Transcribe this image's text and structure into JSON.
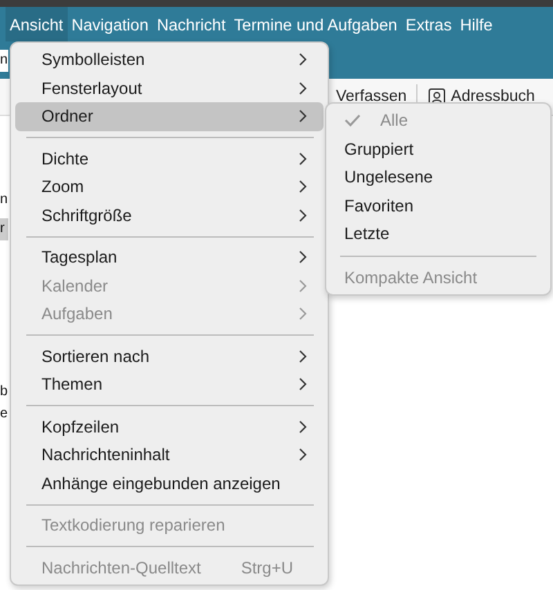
{
  "menubar": [
    {
      "label": "Ansicht",
      "selected": true
    },
    {
      "label": "Navigation",
      "selected": false
    },
    {
      "label": "Nachricht",
      "selected": false
    },
    {
      "label": "Termine und Aufgaben",
      "selected": false
    },
    {
      "label": "Extras",
      "selected": false
    },
    {
      "label": "Hilfe",
      "selected": false
    }
  ],
  "toolbar": [
    {
      "label": "Verfassen"
    },
    {
      "label": "Adressbuch"
    }
  ],
  "left_pane": [
    {
      "text": "n",
      "selected": false
    },
    {
      "text": "n",
      "selected": false
    },
    {
      "text": "r",
      "selected": true
    },
    {
      "text": "b",
      "selected": false
    },
    {
      "text": "e",
      "selected": false
    }
  ],
  "menu": {
    "groups": [
      [
        {
          "kind": "submenu",
          "label": "Symbolleisten",
          "disabled": false,
          "selected": false
        },
        {
          "kind": "submenu",
          "label": "Fensterlayout",
          "disabled": false,
          "selected": false
        },
        {
          "kind": "submenu",
          "label": "Ordner",
          "disabled": false,
          "selected": true
        }
      ],
      [
        {
          "kind": "submenu",
          "label": "Dichte",
          "disabled": false,
          "selected": false
        },
        {
          "kind": "submenu",
          "label": "Zoom",
          "disabled": false,
          "selected": false
        },
        {
          "kind": "submenu",
          "label": "Schriftgröße",
          "disabled": false,
          "selected": false
        }
      ],
      [
        {
          "kind": "submenu",
          "label": "Tagesplan",
          "disabled": false,
          "selected": false
        },
        {
          "kind": "submenu",
          "label": "Kalender",
          "disabled": true,
          "selected": false
        },
        {
          "kind": "submenu",
          "label": "Aufgaben",
          "disabled": true,
          "selected": false
        }
      ],
      [
        {
          "kind": "submenu",
          "label": "Sortieren nach",
          "disabled": false,
          "selected": false
        },
        {
          "kind": "submenu",
          "label": "Themen",
          "disabled": false,
          "selected": false
        }
      ],
      [
        {
          "kind": "submenu",
          "label": "Kopfzeilen",
          "disabled": false,
          "selected": false
        },
        {
          "kind": "submenu",
          "label": "Nachrichteninhalt",
          "disabled": false,
          "selected": false
        },
        {
          "kind": "command",
          "label": "Anhänge eingebunden anzeigen",
          "disabled": false,
          "selected": false
        }
      ],
      [
        {
          "kind": "command",
          "label": "Textkodierung reparieren",
          "disabled": true,
          "selected": false
        }
      ],
      [
        {
          "kind": "command",
          "label": "Nachrichten-Quelltext",
          "disabled": true,
          "selected": false,
          "shortcut": "Strg+U"
        }
      ]
    ]
  },
  "submenu": {
    "groups": [
      [
        {
          "label": "Alle",
          "checked": true,
          "disabled": true
        },
        {
          "label": "Gruppiert",
          "checked": false,
          "disabled": false
        },
        {
          "label": "Ungelesene",
          "checked": false,
          "disabled": false
        },
        {
          "label": "Favoriten",
          "checked": false,
          "disabled": false
        },
        {
          "label": "Letzte",
          "checked": false,
          "disabled": false
        }
      ],
      [
        {
          "label": "Kompakte Ansicht",
          "checked": false,
          "disabled": true
        }
      ]
    ]
  }
}
